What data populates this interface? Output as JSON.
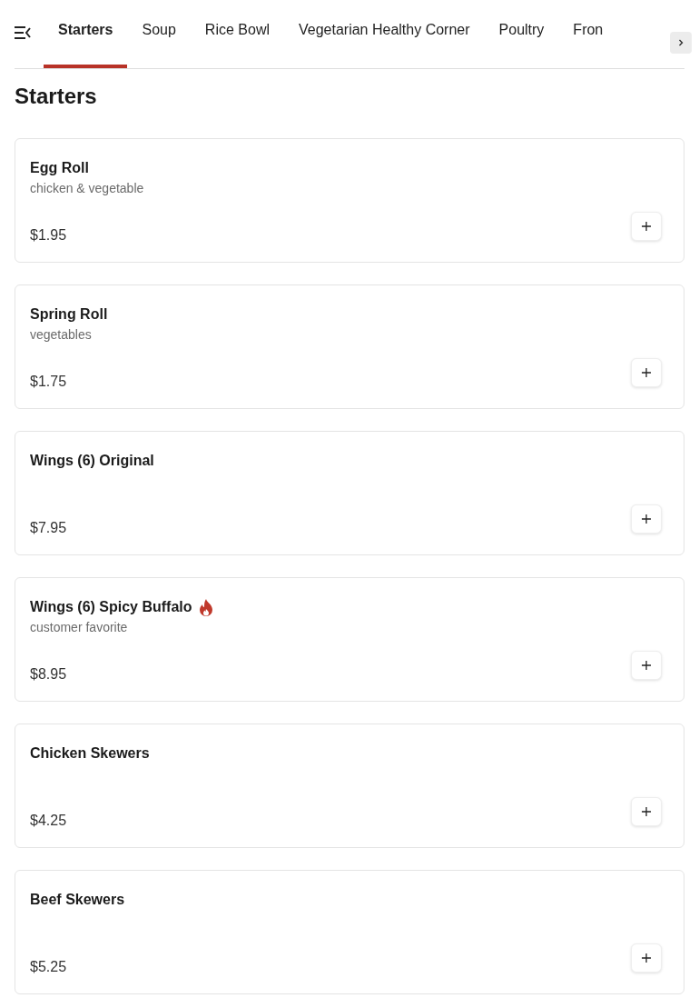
{
  "tabs": [
    {
      "label": "Starters",
      "selected": true
    },
    {
      "label": "Soup",
      "selected": false
    },
    {
      "label": "Rice Bowl",
      "selected": false
    },
    {
      "label": "Vegetarian Healthy Corner",
      "selected": false
    },
    {
      "label": "Poultry",
      "selected": false
    },
    {
      "label": "Fron",
      "selected": false
    }
  ],
  "section_title": "Starters",
  "items": [
    {
      "name": "Egg Roll",
      "description": "chicken & vegetable",
      "price": "$1.95",
      "spicy": false
    },
    {
      "name": "Spring Roll",
      "description": "vegetables",
      "price": "$1.75",
      "spicy": false
    },
    {
      "name": "Wings (6) Original",
      "price": "$7.95",
      "spicy": false
    },
    {
      "name": "Wings (6) Spicy Buffalo",
      "description": "customer favorite",
      "price": "$8.95",
      "spicy": true
    },
    {
      "name": "Chicken Skewers",
      "price": "$4.25",
      "spicy": false
    },
    {
      "name": "Beef Skewers",
      "price": "$5.25",
      "spicy": false
    }
  ]
}
